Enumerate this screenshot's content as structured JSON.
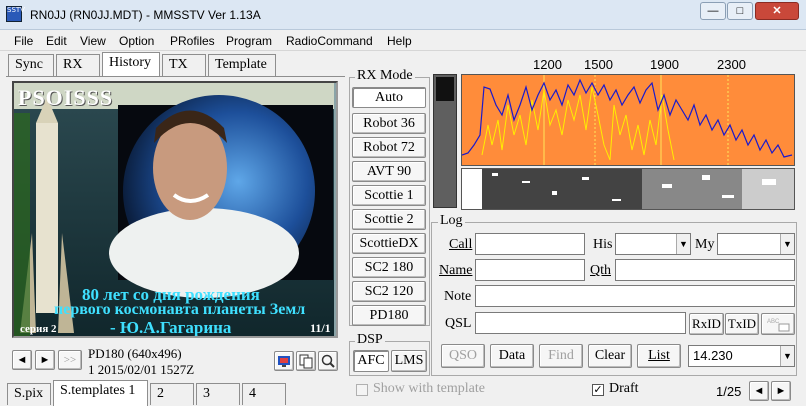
{
  "window": {
    "title": "RN0JJ (RN0JJ.MDT) - MMSSTV Ver 1.13A",
    "icon": "SSTV"
  },
  "controls": {
    "minimize": "—",
    "maximize": "□",
    "close": "✕"
  },
  "menu": [
    "File",
    "Edit",
    "View",
    "Option",
    "PRofiles",
    "Program",
    "RadioCommand",
    "Help"
  ],
  "tabs": [
    "Sync",
    "RX",
    "History",
    "TX",
    "Template"
  ],
  "image": {
    "top_text": "PSOISSS",
    "caption_line1": "80 лет со дня рождения",
    "caption_line2": "первого космонавта планеты Земл",
    "caption_line3": "- Ю.А.Гагарина",
    "series": "серия 2",
    "counter": "11/1"
  },
  "nav": {
    "prev": "◄",
    "next": "►",
    "last": ">>"
  },
  "history_info": {
    "mode": "PD180 (640x496)",
    "date": "1 2015/02/01 1527Z"
  },
  "rx_mode": {
    "label": "RX Mode",
    "options": [
      "Auto",
      "Robot 36",
      "Robot 72",
      "AVT 90",
      "Scottie 1",
      "Scottie 2",
      "ScottieDX",
      "SC2 180",
      "SC2 120",
      "PD180"
    ]
  },
  "dsp": {
    "label": "DSP",
    "afc": "AFC",
    "lms": "LMS"
  },
  "freq_axis": {
    "ticks": [
      "1200",
      "1500",
      "1900",
      "2300"
    ]
  },
  "log": {
    "label": "Log",
    "call_label": "Call",
    "his_label": "His",
    "my_label": "My",
    "name_label": "Name",
    "qth_label": "Qth",
    "note_label": "Note",
    "qsl_label": "QSL",
    "call_value": "",
    "his_value": "",
    "my_value": "",
    "name_value": "",
    "qth_value": "",
    "note_value": "",
    "qsl_value": "",
    "rxid": "RxID",
    "txid": "TxID",
    "qso": "QSO",
    "data": "Data",
    "find": "Find",
    "clear": "Clear",
    "list": "List",
    "freq": "14.230"
  },
  "bottom_tabs": [
    "S.pix",
    "S.templates 1",
    "2",
    "3",
    "4"
  ],
  "show_template": "Show with template",
  "draft": "Draft",
  "page_counter": "1/25",
  "colors": {
    "spectrum_bg": "#ff8c3a",
    "trace_blue": "#1a1acc",
    "trace_yellow": "#ffee00",
    "caption": "#3fe0ff"
  }
}
